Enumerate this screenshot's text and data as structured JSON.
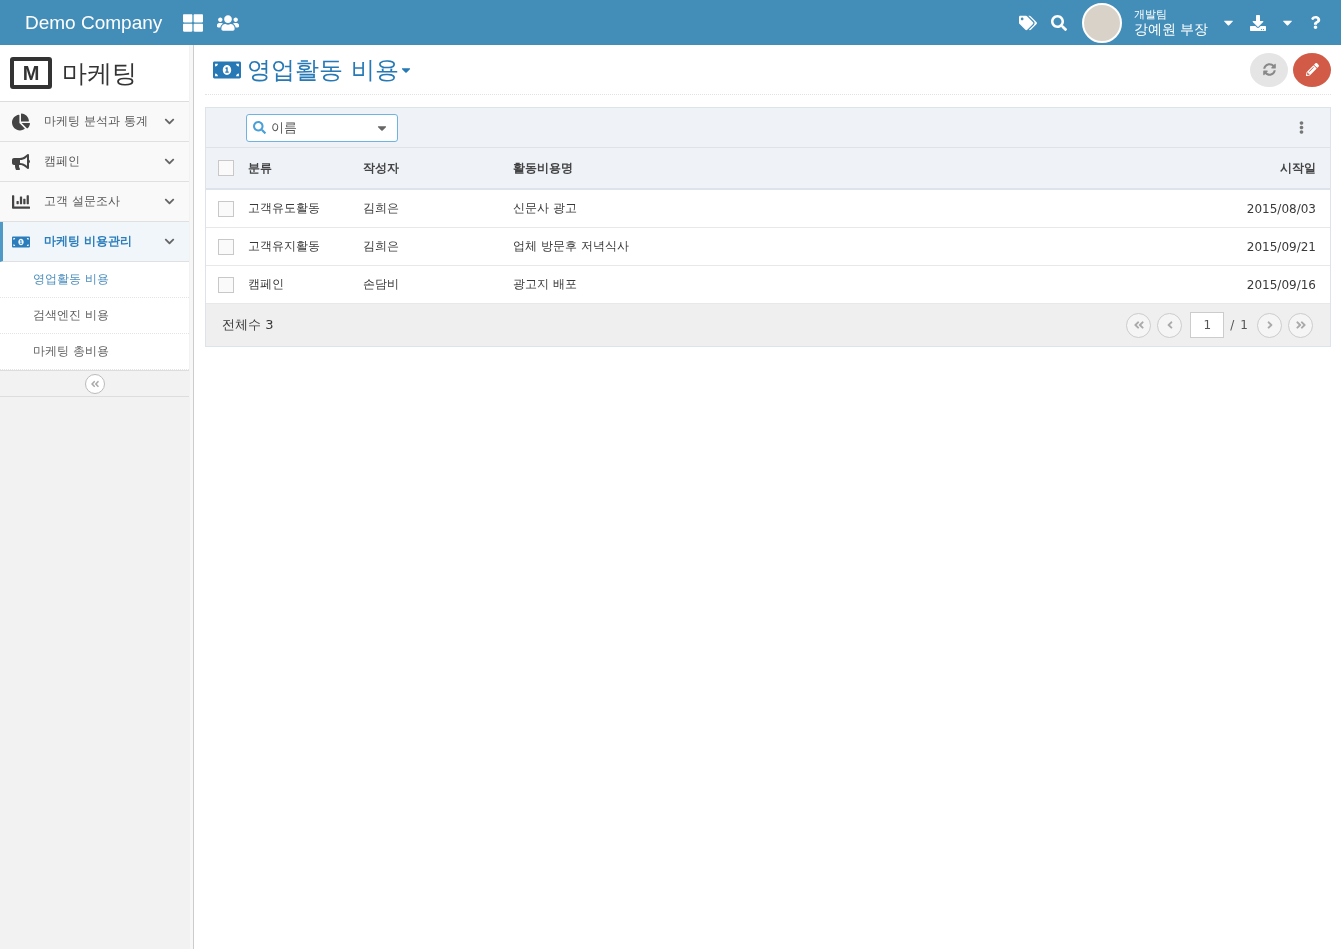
{
  "header": {
    "company": "Demo Company",
    "user_team": "개발팀",
    "user_name": "강예원 부장"
  },
  "sidebar": {
    "logo_letter": "M",
    "title": "마케팅",
    "menu": [
      {
        "label": "마케팅 분석과 통계",
        "selected": false
      },
      {
        "label": "캠페인",
        "selected": false
      },
      {
        "label": "고객 설문조사",
        "selected": false
      },
      {
        "label": "마케팅 비용관리",
        "selected": true,
        "children": [
          {
            "label": "영업활동 비용",
            "selected": true
          },
          {
            "label": "검색엔진 비용",
            "selected": false
          },
          {
            "label": "마케팅 총비용",
            "selected": false
          }
        ]
      }
    ]
  },
  "page": {
    "title": "영업활동 비용"
  },
  "search": {
    "value": "이름"
  },
  "table": {
    "select_all": false,
    "columns": [
      "분류",
      "작성자",
      "활동비용명",
      "시작일"
    ],
    "rows": [
      {
        "checked": false,
        "cells": [
          "고객유도활동",
          "김희은",
          "신문사 광고",
          "2015/08/03"
        ]
      },
      {
        "checked": false,
        "cells": [
          "고객유지활동",
          "김희은",
          "업체 방문후 저녁식사",
          "2015/09/21"
        ]
      },
      {
        "checked": false,
        "cells": [
          "캠페인",
          "손담비",
          "광고지 배포",
          "2015/09/16"
        ]
      }
    ]
  },
  "footer": {
    "total": "전체수 3",
    "page": "1",
    "separator": "/",
    "page_count": "1"
  }
}
